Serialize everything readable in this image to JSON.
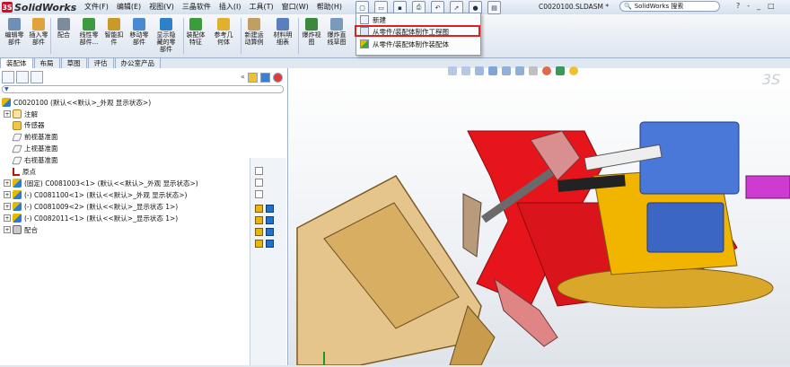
{
  "app": {
    "name": "SolidWorks",
    "document_title": "C0020100.SLDASM *"
  },
  "menubar": [
    "文件(F)",
    "编辑(E)",
    "视图(V)",
    "三晶软件",
    "插入(I)",
    "工具(T)",
    "窗口(W)",
    "帮助(H)"
  ],
  "search": {
    "placeholder": "SolidWorks 搜索"
  },
  "window_controls": [
    "?",
    "-",
    "_",
    "□"
  ],
  "ribbon": [
    {
      "label": "编辑零部件",
      "icon": "edit-component-icon"
    },
    {
      "label": "插入零部件",
      "icon": "insert-component-icon"
    },
    {
      "label": "配合",
      "icon": "mate-icon"
    },
    {
      "label": "线性零部件...",
      "icon": "linear-pattern-icon"
    },
    {
      "label": "智能扣件",
      "icon": "smart-fastener-icon"
    },
    {
      "label": "移动零部件",
      "icon": "move-component-icon"
    },
    {
      "label": "显示隐藏的零部件",
      "icon": "show-hidden-icon"
    },
    {
      "label": "装配体特征",
      "icon": "assembly-feature-icon"
    },
    {
      "label": "参考几何体",
      "icon": "reference-geometry-icon"
    },
    {
      "label": "新建运动算例",
      "icon": "motion-study-icon"
    },
    {
      "label": "材料明细表",
      "icon": "bom-icon"
    },
    {
      "label": "爆炸视图",
      "icon": "exploded-view-icon"
    },
    {
      "label": "爆炸直线草图",
      "icon": "explode-line-icon"
    }
  ],
  "dropdown": {
    "items": [
      {
        "label": "新建",
        "icon": "new-document-icon"
      },
      {
        "label": "从零件/装配体制作工程图",
        "icon": "drawing-icon"
      },
      {
        "label": "从零件/装配体制作装配体",
        "icon": "assembly-icon"
      }
    ],
    "highlighted_index": 1
  },
  "tabs": [
    "装配体",
    "布局",
    "草图",
    "评估",
    "办公室产品"
  ],
  "active_tab": 0,
  "tree": {
    "root": "C0020100 (默认<<默认>_外观 显示状态>)",
    "items": [
      {
        "label": "注解",
        "icon": "annotations-icon",
        "toggle": "+"
      },
      {
        "label": "传感器",
        "icon": "sensor-icon",
        "toggle": ""
      },
      {
        "label": "前视基准面",
        "icon": "plane-icon",
        "toggle": ""
      },
      {
        "label": "上视基准面",
        "icon": "plane-icon",
        "toggle": ""
      },
      {
        "label": "右视基准面",
        "icon": "plane-icon",
        "toggle": ""
      },
      {
        "label": "原点",
        "icon": "origin-icon",
        "toggle": ""
      },
      {
        "label": "(固定) C0081003<1> (默认<<默认>_外观 显示状态>)",
        "icon": "part-icon",
        "toggle": "+"
      },
      {
        "label": "(-) C0081100<1> (默认<<默认>_外观 显示状态>)",
        "icon": "part-icon",
        "toggle": "+"
      },
      {
        "label": "(-) C0081009<2> (默认<<默认>_显示状态 1>)",
        "icon": "part-icon",
        "toggle": "+"
      },
      {
        "label": "(-) C0082011<1> (默认<<默认>_显示状态 1>)",
        "icon": "part-icon",
        "toggle": "+"
      },
      {
        "label": "配合",
        "icon": "mates-icon",
        "toggle": "+"
      }
    ]
  },
  "colors": {
    "accent": "#c8102e",
    "highlight_box": "#e01f1f",
    "ribbon": "#dde5ef"
  }
}
